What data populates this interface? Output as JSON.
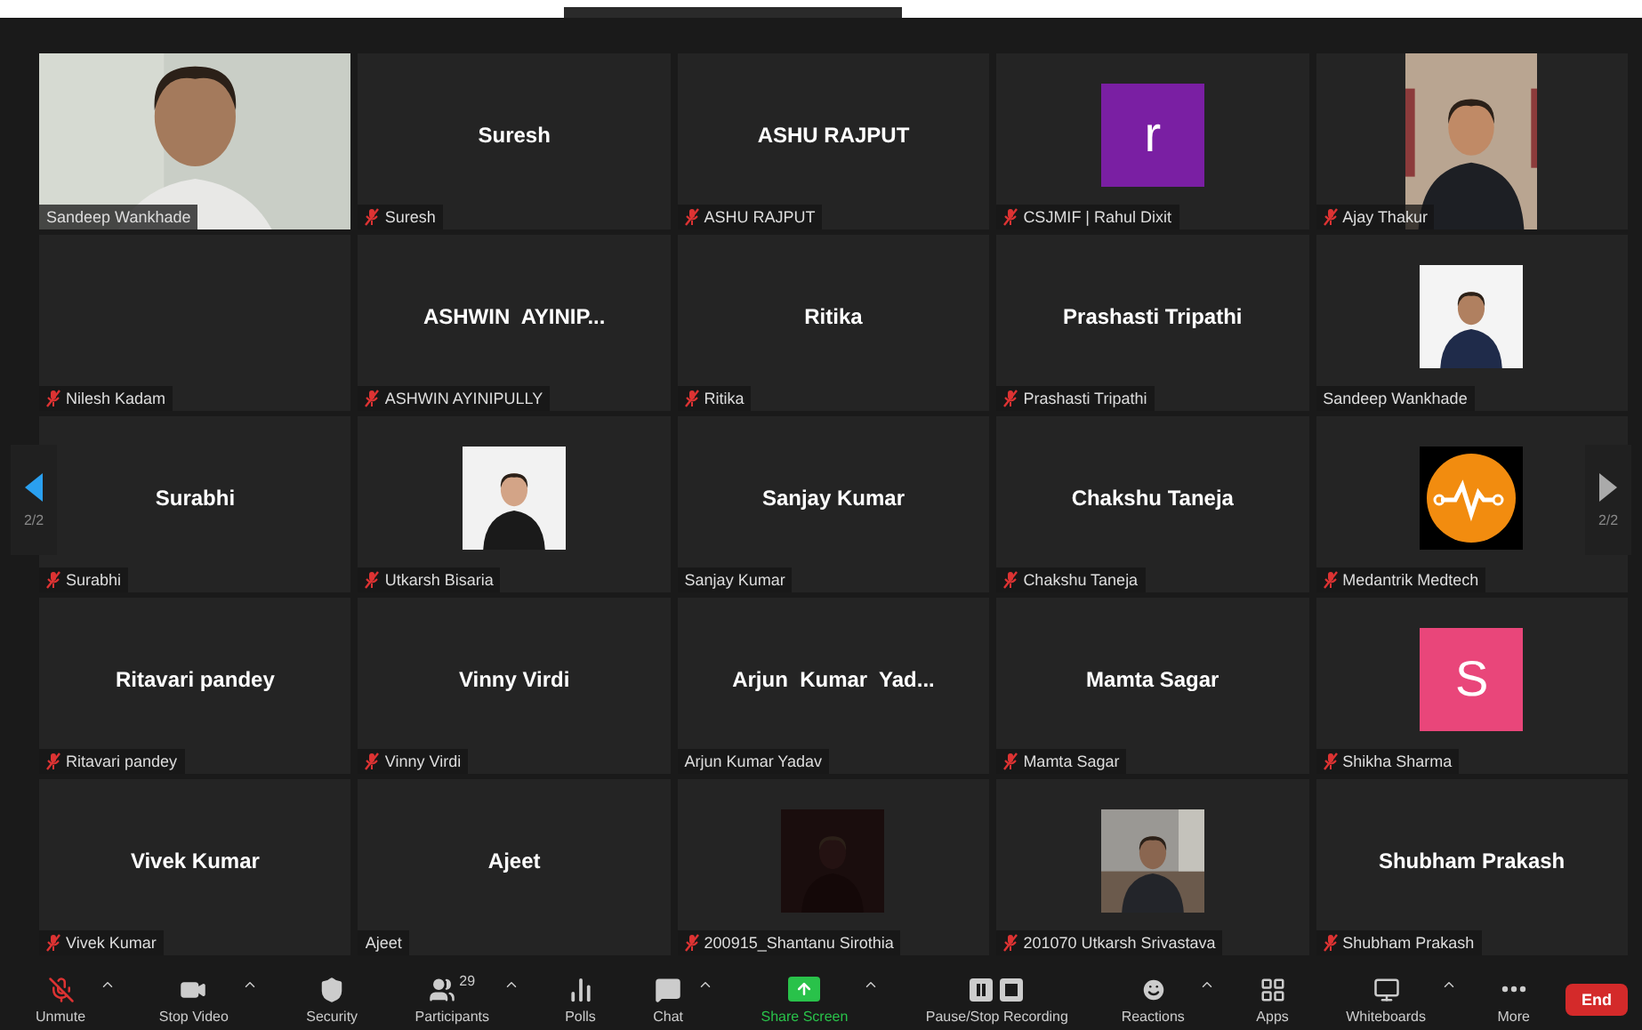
{
  "pager": {
    "left": {
      "label": "2/2",
      "enabled": true
    },
    "right": {
      "label": "2/2",
      "enabled": false
    }
  },
  "tiles": [
    {
      "kind": "video",
      "label": "Sandeep Wankhade",
      "muted": false
    },
    {
      "kind": "name",
      "title": "Suresh",
      "label": "Suresh",
      "muted": true
    },
    {
      "kind": "name",
      "title": "ASHU RAJPUT",
      "label": "ASHU RAJPUT",
      "muted": true
    },
    {
      "kind": "letter",
      "letter": "r",
      "color": "#7a1fa3",
      "label": "CSJMIF | Rahul Dixit",
      "muted": true
    },
    {
      "kind": "portrait",
      "label": "Ajay Thakur",
      "muted": true
    },
    {
      "kind": "blank",
      "label": "Nilesh Kadam",
      "muted": true
    },
    {
      "kind": "name",
      "title": "ASHWIN  AYINIP...",
      "label": "ASHWIN AYINIPULLY",
      "muted": true
    },
    {
      "kind": "name",
      "title": "Ritika",
      "label": "Ritika",
      "muted": true
    },
    {
      "kind": "name",
      "title": "Prashasti Tripathi",
      "label": "Prashasti Tripathi",
      "muted": true
    },
    {
      "label": "Sandeep Wankhade",
      "muted": false
    },
    {
      "kind": "name",
      "title": "Surabhi",
      "label": "Surabhi",
      "muted": true
    },
    {
      "label": "Utkarsh Bisaria",
      "muted": true
    },
    {
      "kind": "name",
      "title": "Sanjay Kumar",
      "label": "Sanjay Kumar",
      "muted": false
    },
    {
      "kind": "name",
      "title": "Chakshu Taneja",
      "label": "Chakshu Taneja",
      "muted": true
    },
    {
      "kind": "logo",
      "label": "Medantrik Medtech",
      "muted": true
    },
    {
      "kind": "name",
      "title": "Ritavari pandey",
      "label": "Ritavari pandey",
      "muted": true
    },
    {
      "kind": "name",
      "title": "Vinny Virdi",
      "label": "Vinny Virdi",
      "muted": true
    },
    {
      "kind": "name",
      "title": "Arjun  Kumar  Yad...",
      "label": "Arjun Kumar Yadav",
      "muted": false
    },
    {
      "kind": "name",
      "title": "Mamta Sagar",
      "label": "Mamta Sagar",
      "muted": true
    },
    {
      "kind": "letter",
      "letter": "S",
      "color": "#e9467a",
      "label": "Shikha Sharma",
      "muted": true
    },
    {
      "kind": "name",
      "title": "Vivek Kumar",
      "label": "Vivek Kumar",
      "muted": true
    },
    {
      "kind": "name",
      "title": "Ajeet",
      "label": "Ajeet",
      "muted": false
    },
    {
      "label": "200915_Shantanu Sirothia",
      "muted": true
    },
    {
      "label": "201070 Utkarsh Srivastava",
      "muted": true
    },
    {
      "kind": "name",
      "title": "Shubham Prakash",
      "label": "Shubham Prakash",
      "muted": true
    }
  ],
  "toolbar": [
    {
      "label": "Unmute",
      "caret": true,
      "muted": true
    },
    {
      "label": "Stop Video",
      "caret": true
    },
    {
      "label": "Security",
      "caret": false
    },
    {
      "label": "Participants",
      "caret": true,
      "count": "29"
    },
    {
      "label": "Polls",
      "caret": false
    },
    {
      "label": "Chat",
      "caret": true
    },
    {
      "label": "Share Screen",
      "caret": true,
      "highlight": true
    },
    {
      "label": "Pause/Stop Recording",
      "caret": false
    },
    {
      "label": "Reactions",
      "caret": true
    },
    {
      "label": "Apps",
      "caret": false
    },
    {
      "label": "Whiteboards",
      "caret": true
    },
    {
      "label": "More",
      "caret": false
    }
  ],
  "end_button": "End"
}
